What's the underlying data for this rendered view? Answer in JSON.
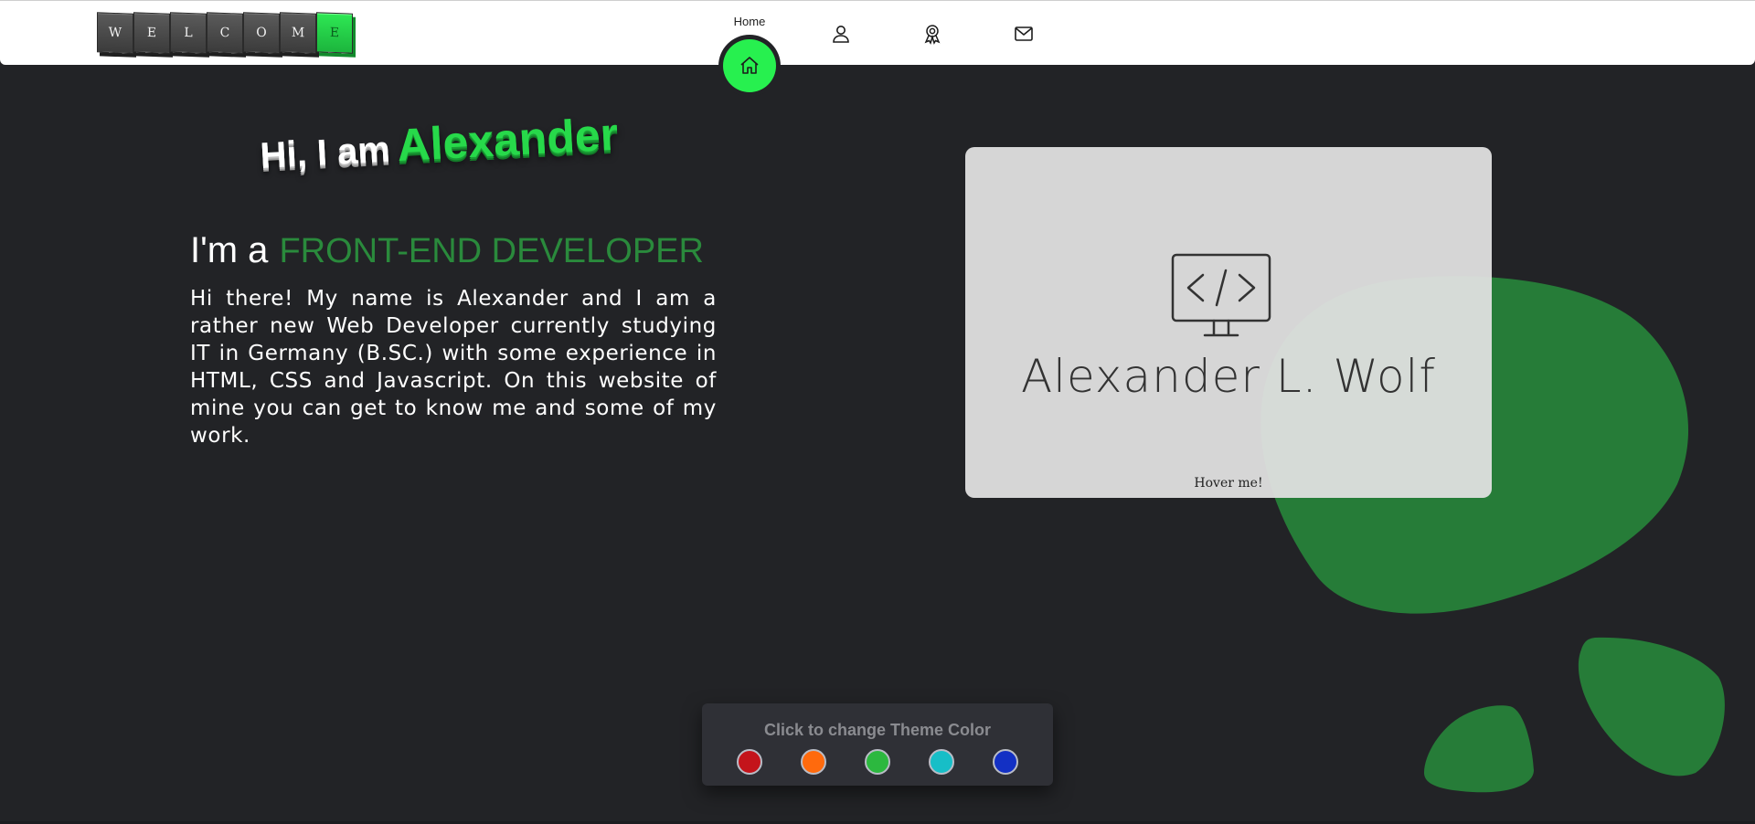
{
  "logo": {
    "letters": [
      "W",
      "E",
      "L",
      "C",
      "O",
      "M",
      "E"
    ]
  },
  "nav": {
    "home_label": "Home",
    "items": [
      {
        "icon": "home-icon"
      },
      {
        "icon": "user-icon"
      },
      {
        "icon": "award-icon"
      },
      {
        "icon": "mail-icon"
      }
    ]
  },
  "hero": {
    "greeting_plain": "Hi, I am",
    "greeting_name": "Alexander",
    "role_prefix": "I'm a",
    "role_title": "FRONT-END DEVELOPER",
    "intro": "Hi there! My name is Alexander and I am a rather new Web Developer currently studying IT in Germany (B.SC.) with some experience in HTML, CSS and Javascript. On this website of mine you can get to know me and some of my work."
  },
  "card": {
    "name": "Alexander L. Wolf",
    "hover_hint": "Hover me!",
    "icon": "code-monitor-icon"
  },
  "theme": {
    "title": "Click to change Theme Color",
    "colors": [
      {
        "name": "red",
        "hex": "#c4141b"
      },
      {
        "name": "orange",
        "hex": "#ff6a0d"
      },
      {
        "name": "green",
        "hex": "#2cb83f"
      },
      {
        "name": "cyan",
        "hex": "#17bec7"
      },
      {
        "name": "blue",
        "hex": "#1330c4"
      }
    ]
  },
  "colors": {
    "background": "#222326",
    "accent": "#27f04f",
    "accent_dark": "#267c38",
    "navbar": "#ffffff"
  }
}
